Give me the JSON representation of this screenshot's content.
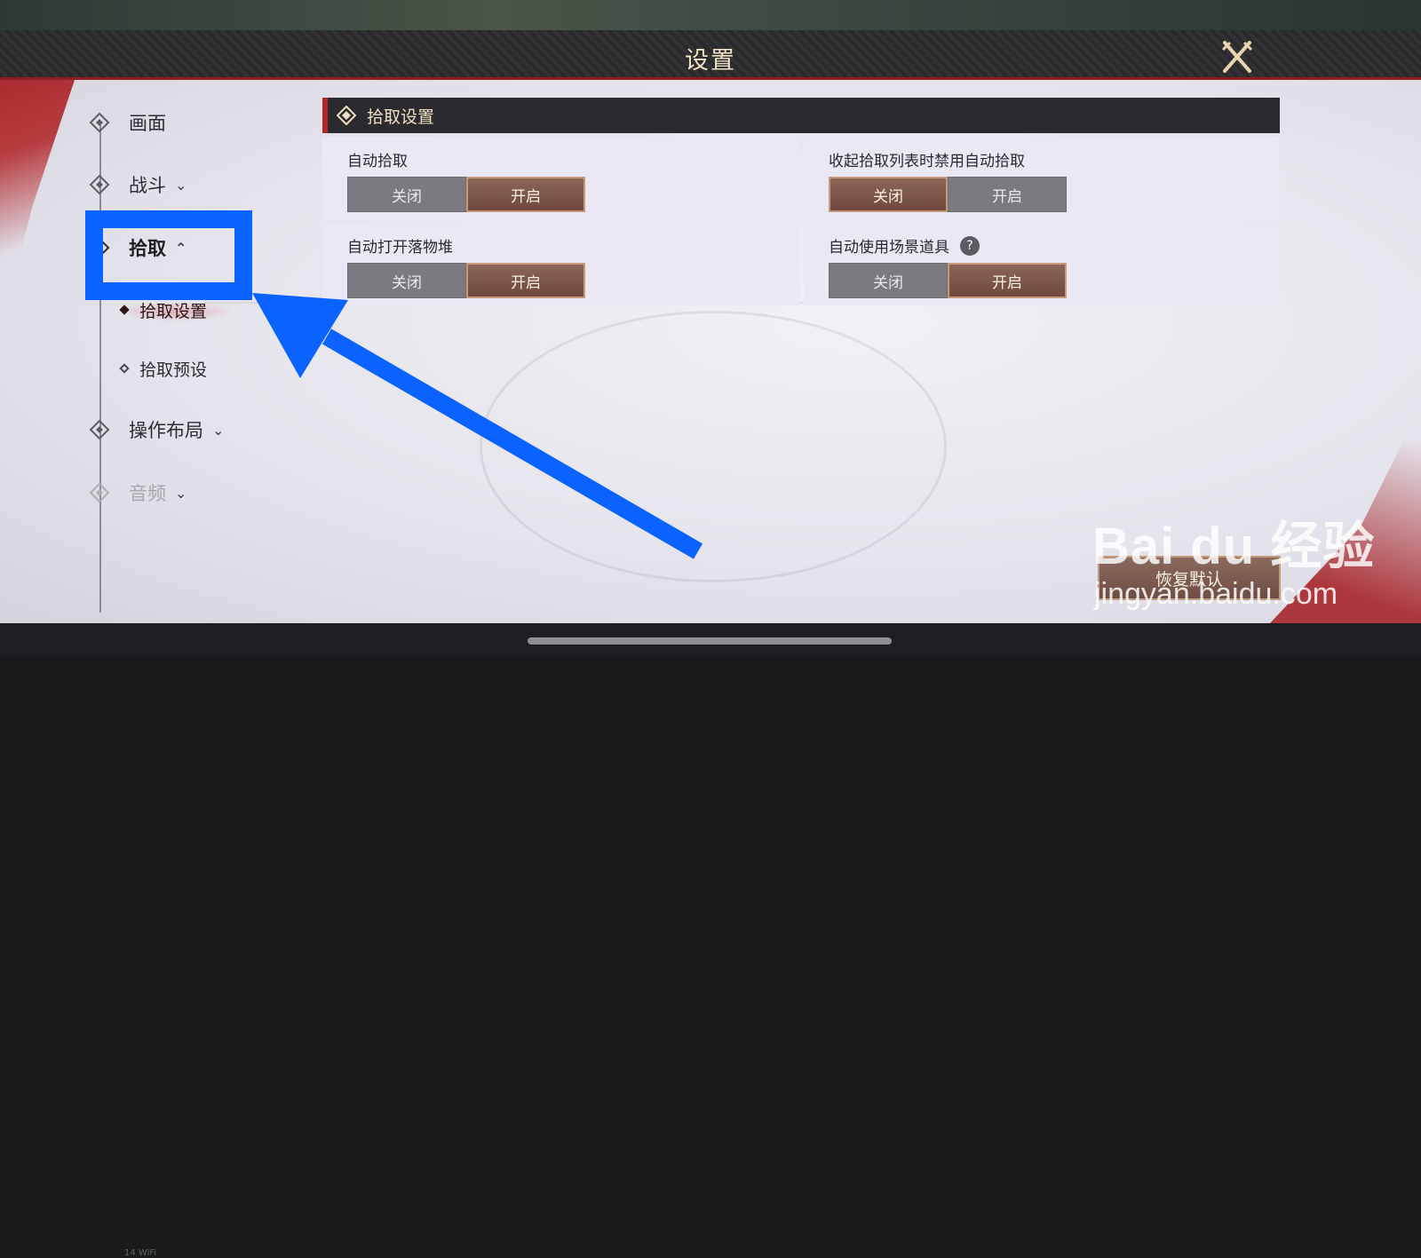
{
  "header": {
    "title": "设置",
    "close_icon": "crossed-blades-close-icon"
  },
  "sidebar": {
    "items": [
      {
        "label": "画面",
        "chevron": ""
      },
      {
        "label": "战斗",
        "chevron": "⌄"
      },
      {
        "label": "拾取",
        "chevron": "⌃"
      },
      {
        "label": "操作布局",
        "chevron": "⌄"
      },
      {
        "label": "音频",
        "chevron": "⌄"
      }
    ],
    "sub_items": [
      {
        "label": "拾取设置"
      },
      {
        "label": "拾取预设"
      }
    ]
  },
  "section": {
    "title": "拾取设置",
    "settings": [
      {
        "label": "自动拾取",
        "off": "关闭",
        "on": "开启",
        "selected": "on"
      },
      {
        "label": "收起拾取列表时禁用自动拾取",
        "off": "关闭",
        "on": "开启",
        "selected": "off"
      },
      {
        "label": "自动打开落物堆",
        "off": "关闭",
        "on": "开启",
        "selected": "on"
      },
      {
        "label": "自动使用场景道具",
        "off": "关闭",
        "on": "开启",
        "selected": "on",
        "help": "?"
      }
    ]
  },
  "footer": {
    "reset_label": "恢复默认"
  },
  "watermark": {
    "logo": "Bai du 经验",
    "url": "jingyan.baidu.com"
  },
  "status": {
    "text": "14 WiFi"
  },
  "colors": {
    "accent_red": "#b3262a",
    "selected_toggle": "#7d5549",
    "annotation_blue": "#0a62ff"
  }
}
